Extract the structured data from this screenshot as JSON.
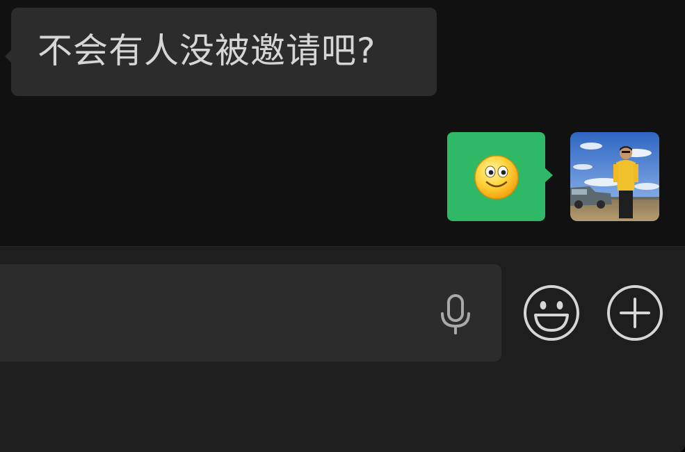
{
  "chat": {
    "messages": [
      {
        "direction": "incoming",
        "text": "不会有人没被邀请吧?"
      },
      {
        "direction": "outgoing",
        "content": "smile-emoji"
      }
    ]
  },
  "input_bar": {
    "text_value": "",
    "icons": {
      "voice": "microphone-icon",
      "emoji": "smiley-face-icon",
      "more": "plus-circle-icon"
    }
  },
  "colors": {
    "background": "#111111",
    "incoming_bubble": "#2c2c2c",
    "outgoing_bubble": "#2fb866",
    "input_bar": "#1e1e1e",
    "icon": "#d6d6d6"
  }
}
